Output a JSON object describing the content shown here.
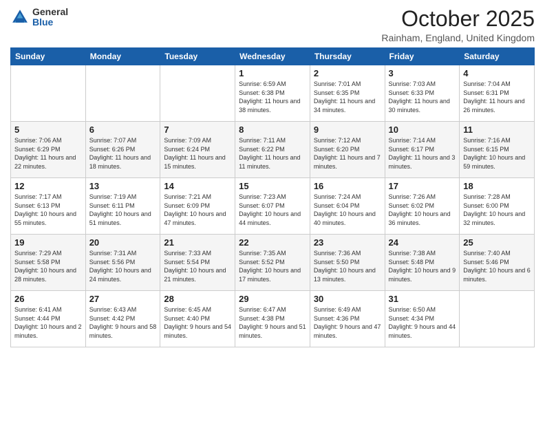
{
  "header": {
    "logo_general": "General",
    "logo_blue": "Blue",
    "month": "October 2025",
    "location": "Rainham, England, United Kingdom"
  },
  "weekdays": [
    "Sunday",
    "Monday",
    "Tuesday",
    "Wednesday",
    "Thursday",
    "Friday",
    "Saturday"
  ],
  "weeks": [
    [
      {
        "day": "",
        "sunrise": "",
        "sunset": "",
        "daylight": ""
      },
      {
        "day": "",
        "sunrise": "",
        "sunset": "",
        "daylight": ""
      },
      {
        "day": "",
        "sunrise": "",
        "sunset": "",
        "daylight": ""
      },
      {
        "day": "1",
        "sunrise": "Sunrise: 6:59 AM",
        "sunset": "Sunset: 6:38 PM",
        "daylight": "Daylight: 11 hours and 38 minutes."
      },
      {
        "day": "2",
        "sunrise": "Sunrise: 7:01 AM",
        "sunset": "Sunset: 6:35 PM",
        "daylight": "Daylight: 11 hours and 34 minutes."
      },
      {
        "day": "3",
        "sunrise": "Sunrise: 7:03 AM",
        "sunset": "Sunset: 6:33 PM",
        "daylight": "Daylight: 11 hours and 30 minutes."
      },
      {
        "day": "4",
        "sunrise": "Sunrise: 7:04 AM",
        "sunset": "Sunset: 6:31 PM",
        "daylight": "Daylight: 11 hours and 26 minutes."
      }
    ],
    [
      {
        "day": "5",
        "sunrise": "Sunrise: 7:06 AM",
        "sunset": "Sunset: 6:29 PM",
        "daylight": "Daylight: 11 hours and 22 minutes."
      },
      {
        "day": "6",
        "sunrise": "Sunrise: 7:07 AM",
        "sunset": "Sunset: 6:26 PM",
        "daylight": "Daylight: 11 hours and 18 minutes."
      },
      {
        "day": "7",
        "sunrise": "Sunrise: 7:09 AM",
        "sunset": "Sunset: 6:24 PM",
        "daylight": "Daylight: 11 hours and 15 minutes."
      },
      {
        "day": "8",
        "sunrise": "Sunrise: 7:11 AM",
        "sunset": "Sunset: 6:22 PM",
        "daylight": "Daylight: 11 hours and 11 minutes."
      },
      {
        "day": "9",
        "sunrise": "Sunrise: 7:12 AM",
        "sunset": "Sunset: 6:20 PM",
        "daylight": "Daylight: 11 hours and 7 minutes."
      },
      {
        "day": "10",
        "sunrise": "Sunrise: 7:14 AM",
        "sunset": "Sunset: 6:17 PM",
        "daylight": "Daylight: 11 hours and 3 minutes."
      },
      {
        "day": "11",
        "sunrise": "Sunrise: 7:16 AM",
        "sunset": "Sunset: 6:15 PM",
        "daylight": "Daylight: 10 hours and 59 minutes."
      }
    ],
    [
      {
        "day": "12",
        "sunrise": "Sunrise: 7:17 AM",
        "sunset": "Sunset: 6:13 PM",
        "daylight": "Daylight: 10 hours and 55 minutes."
      },
      {
        "day": "13",
        "sunrise": "Sunrise: 7:19 AM",
        "sunset": "Sunset: 6:11 PM",
        "daylight": "Daylight: 10 hours and 51 minutes."
      },
      {
        "day": "14",
        "sunrise": "Sunrise: 7:21 AM",
        "sunset": "Sunset: 6:09 PM",
        "daylight": "Daylight: 10 hours and 47 minutes."
      },
      {
        "day": "15",
        "sunrise": "Sunrise: 7:23 AM",
        "sunset": "Sunset: 6:07 PM",
        "daylight": "Daylight: 10 hours and 44 minutes."
      },
      {
        "day": "16",
        "sunrise": "Sunrise: 7:24 AM",
        "sunset": "Sunset: 6:04 PM",
        "daylight": "Daylight: 10 hours and 40 minutes."
      },
      {
        "day": "17",
        "sunrise": "Sunrise: 7:26 AM",
        "sunset": "Sunset: 6:02 PM",
        "daylight": "Daylight: 10 hours and 36 minutes."
      },
      {
        "day": "18",
        "sunrise": "Sunrise: 7:28 AM",
        "sunset": "Sunset: 6:00 PM",
        "daylight": "Daylight: 10 hours and 32 minutes."
      }
    ],
    [
      {
        "day": "19",
        "sunrise": "Sunrise: 7:29 AM",
        "sunset": "Sunset: 5:58 PM",
        "daylight": "Daylight: 10 hours and 28 minutes."
      },
      {
        "day": "20",
        "sunrise": "Sunrise: 7:31 AM",
        "sunset": "Sunset: 5:56 PM",
        "daylight": "Daylight: 10 hours and 24 minutes."
      },
      {
        "day": "21",
        "sunrise": "Sunrise: 7:33 AM",
        "sunset": "Sunset: 5:54 PM",
        "daylight": "Daylight: 10 hours and 21 minutes."
      },
      {
        "day": "22",
        "sunrise": "Sunrise: 7:35 AM",
        "sunset": "Sunset: 5:52 PM",
        "daylight": "Daylight: 10 hours and 17 minutes."
      },
      {
        "day": "23",
        "sunrise": "Sunrise: 7:36 AM",
        "sunset": "Sunset: 5:50 PM",
        "daylight": "Daylight: 10 hours and 13 minutes."
      },
      {
        "day": "24",
        "sunrise": "Sunrise: 7:38 AM",
        "sunset": "Sunset: 5:48 PM",
        "daylight": "Daylight: 10 hours and 9 minutes."
      },
      {
        "day": "25",
        "sunrise": "Sunrise: 7:40 AM",
        "sunset": "Sunset: 5:46 PM",
        "daylight": "Daylight: 10 hours and 6 minutes."
      }
    ],
    [
      {
        "day": "26",
        "sunrise": "Sunrise: 6:41 AM",
        "sunset": "Sunset: 4:44 PM",
        "daylight": "Daylight: 10 hours and 2 minutes."
      },
      {
        "day": "27",
        "sunrise": "Sunrise: 6:43 AM",
        "sunset": "Sunset: 4:42 PM",
        "daylight": "Daylight: 9 hours and 58 minutes."
      },
      {
        "day": "28",
        "sunrise": "Sunrise: 6:45 AM",
        "sunset": "Sunset: 4:40 PM",
        "daylight": "Daylight: 9 hours and 54 minutes."
      },
      {
        "day": "29",
        "sunrise": "Sunrise: 6:47 AM",
        "sunset": "Sunset: 4:38 PM",
        "daylight": "Daylight: 9 hours and 51 minutes."
      },
      {
        "day": "30",
        "sunrise": "Sunrise: 6:49 AM",
        "sunset": "Sunset: 4:36 PM",
        "daylight": "Daylight: 9 hours and 47 minutes."
      },
      {
        "day": "31",
        "sunrise": "Sunrise: 6:50 AM",
        "sunset": "Sunset: 4:34 PM",
        "daylight": "Daylight: 9 hours and 44 minutes."
      },
      {
        "day": "",
        "sunrise": "",
        "sunset": "",
        "daylight": ""
      }
    ]
  ]
}
